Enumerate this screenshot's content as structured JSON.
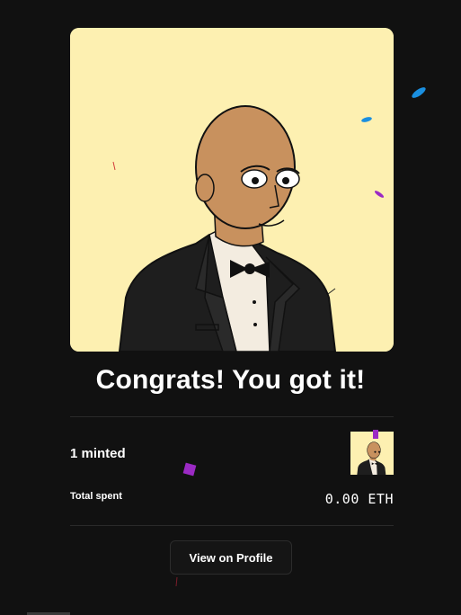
{
  "result": {
    "title": "Congrats! You got it!"
  },
  "mint": {
    "count_label": "1 minted",
    "total_spent_label": "Total spent",
    "total_spent_value": "0.00 ETH"
  },
  "actions": {
    "view_profile_label": "View on Profile"
  },
  "colors": {
    "background": "#111111",
    "card_background": "#fdf0b1",
    "confetti_blue": "#1a8fe0",
    "confetti_purple": "#9b2ac4",
    "confetti_red": "#d23a3a"
  }
}
